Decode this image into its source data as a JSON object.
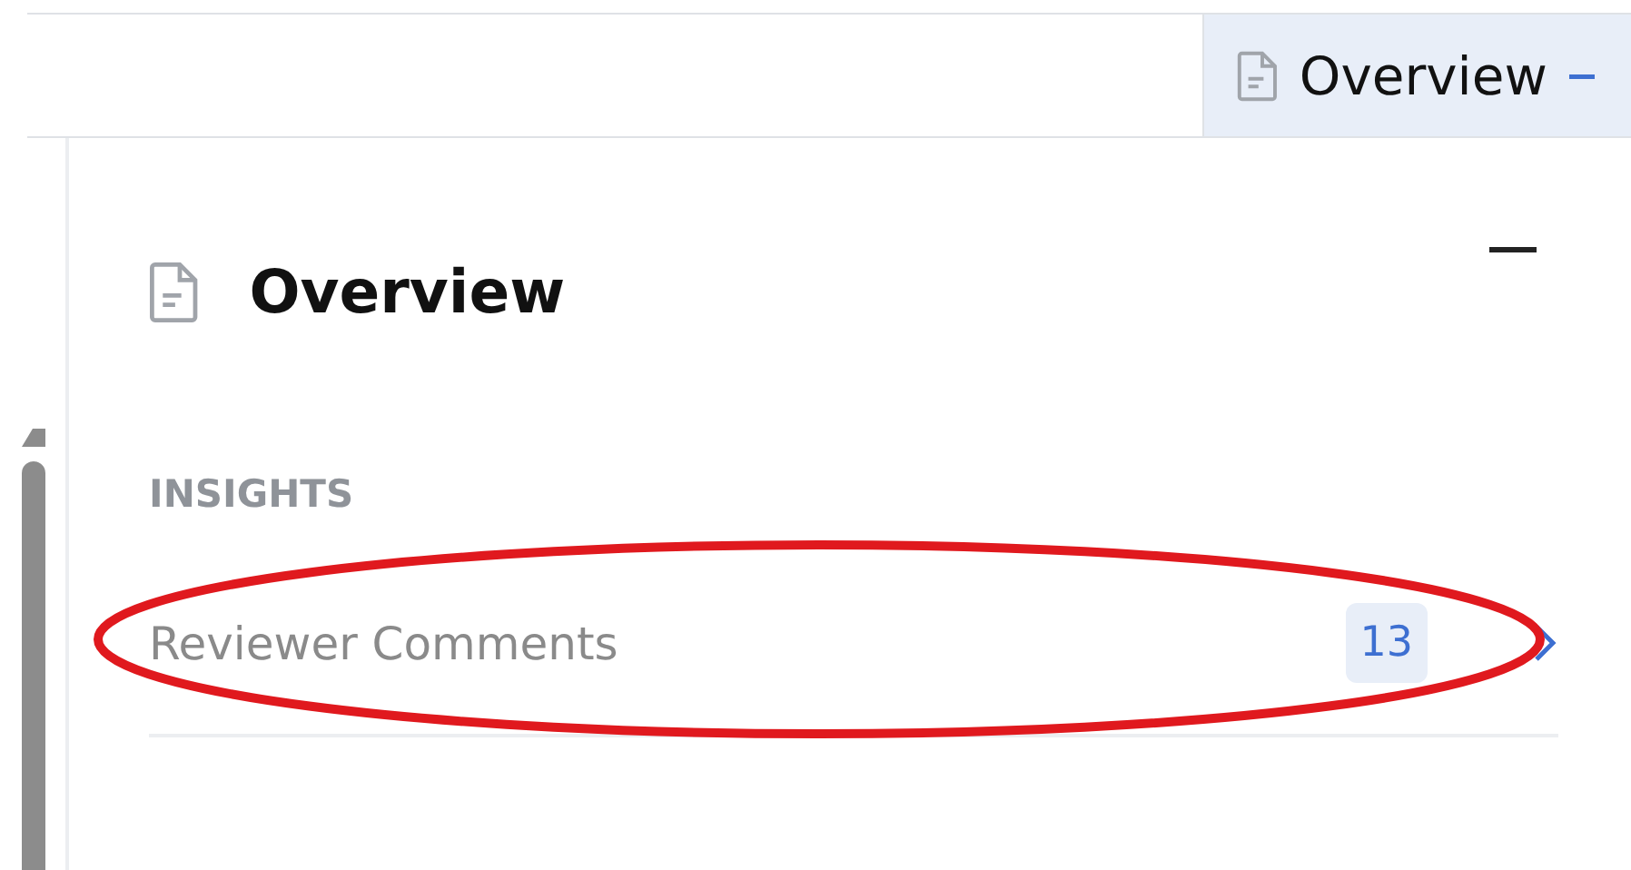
{
  "tab_bar": {
    "tabs": [
      {
        "label": "Overview",
        "selected": true
      }
    ]
  },
  "panel": {
    "title": "Overview",
    "sections": [
      {
        "heading": "INSIGHTS",
        "items": [
          {
            "label": "Reviewer Comments",
            "count": "13",
            "highlighted": true
          }
        ]
      }
    ]
  }
}
